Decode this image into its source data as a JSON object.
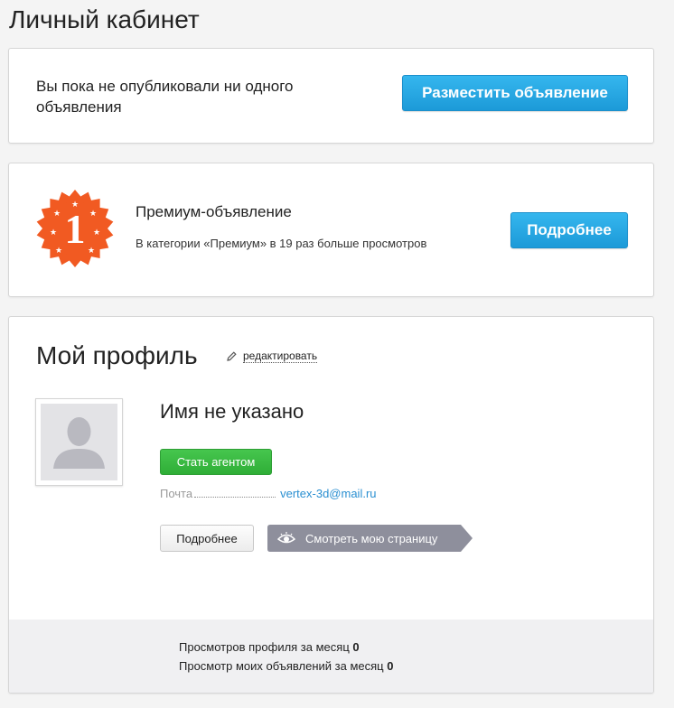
{
  "page": {
    "title": "Личный кабинет"
  },
  "empty_ads": {
    "message": "Вы пока не опубликовали ни одного объявления",
    "place_button": "Разместить объявление"
  },
  "premium": {
    "badge_number": "1",
    "badge_color": "#f15a22",
    "title": "Премиум-объявление",
    "subtitle": "В категории «Премиум» в 19 раз больше просмотров",
    "more_button": "Подробнее"
  },
  "profile": {
    "title": "Мой профиль",
    "edit_label": "редактировать",
    "name": "Имя не указано",
    "become_agent_button": "Стать агентом",
    "email_label": "Почта",
    "email_value": "vertex-3d@mail.ru",
    "more_button": "Подробнее",
    "view_page_button": "Смотреть мою страницу"
  },
  "stats": {
    "profile_views_label": "Просмотров профиля за месяц",
    "profile_views_value": "0",
    "ads_views_label": "Просмотр моих объявлений за месяц",
    "ads_views_value": "0"
  },
  "colors": {
    "accent_blue": "#1c9ad8",
    "accent_green": "#2fae37",
    "link_blue": "#2a8fd1",
    "view_button_grey": "#8e8f9c"
  }
}
